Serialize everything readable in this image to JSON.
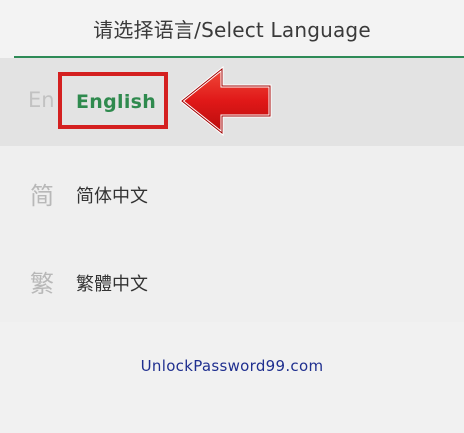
{
  "header": {
    "title": "请选择语言/Select Language"
  },
  "languages": [
    {
      "icon_letter": "En",
      "label": "English",
      "selected": true
    },
    {
      "icon_letter": "简",
      "label": "简体中文",
      "selected": false
    },
    {
      "icon_letter": "繁",
      "label": "繁體中文",
      "selected": false
    }
  ],
  "annotation": {
    "arrow_icon": "left-arrow-icon",
    "highlight_color": "#d42020"
  },
  "watermark": "UnlockPassword99.com",
  "colors": {
    "accent_green": "#2e8b57",
    "selected_text": "#2f8a4e",
    "watermark": "#1f2f8f"
  }
}
